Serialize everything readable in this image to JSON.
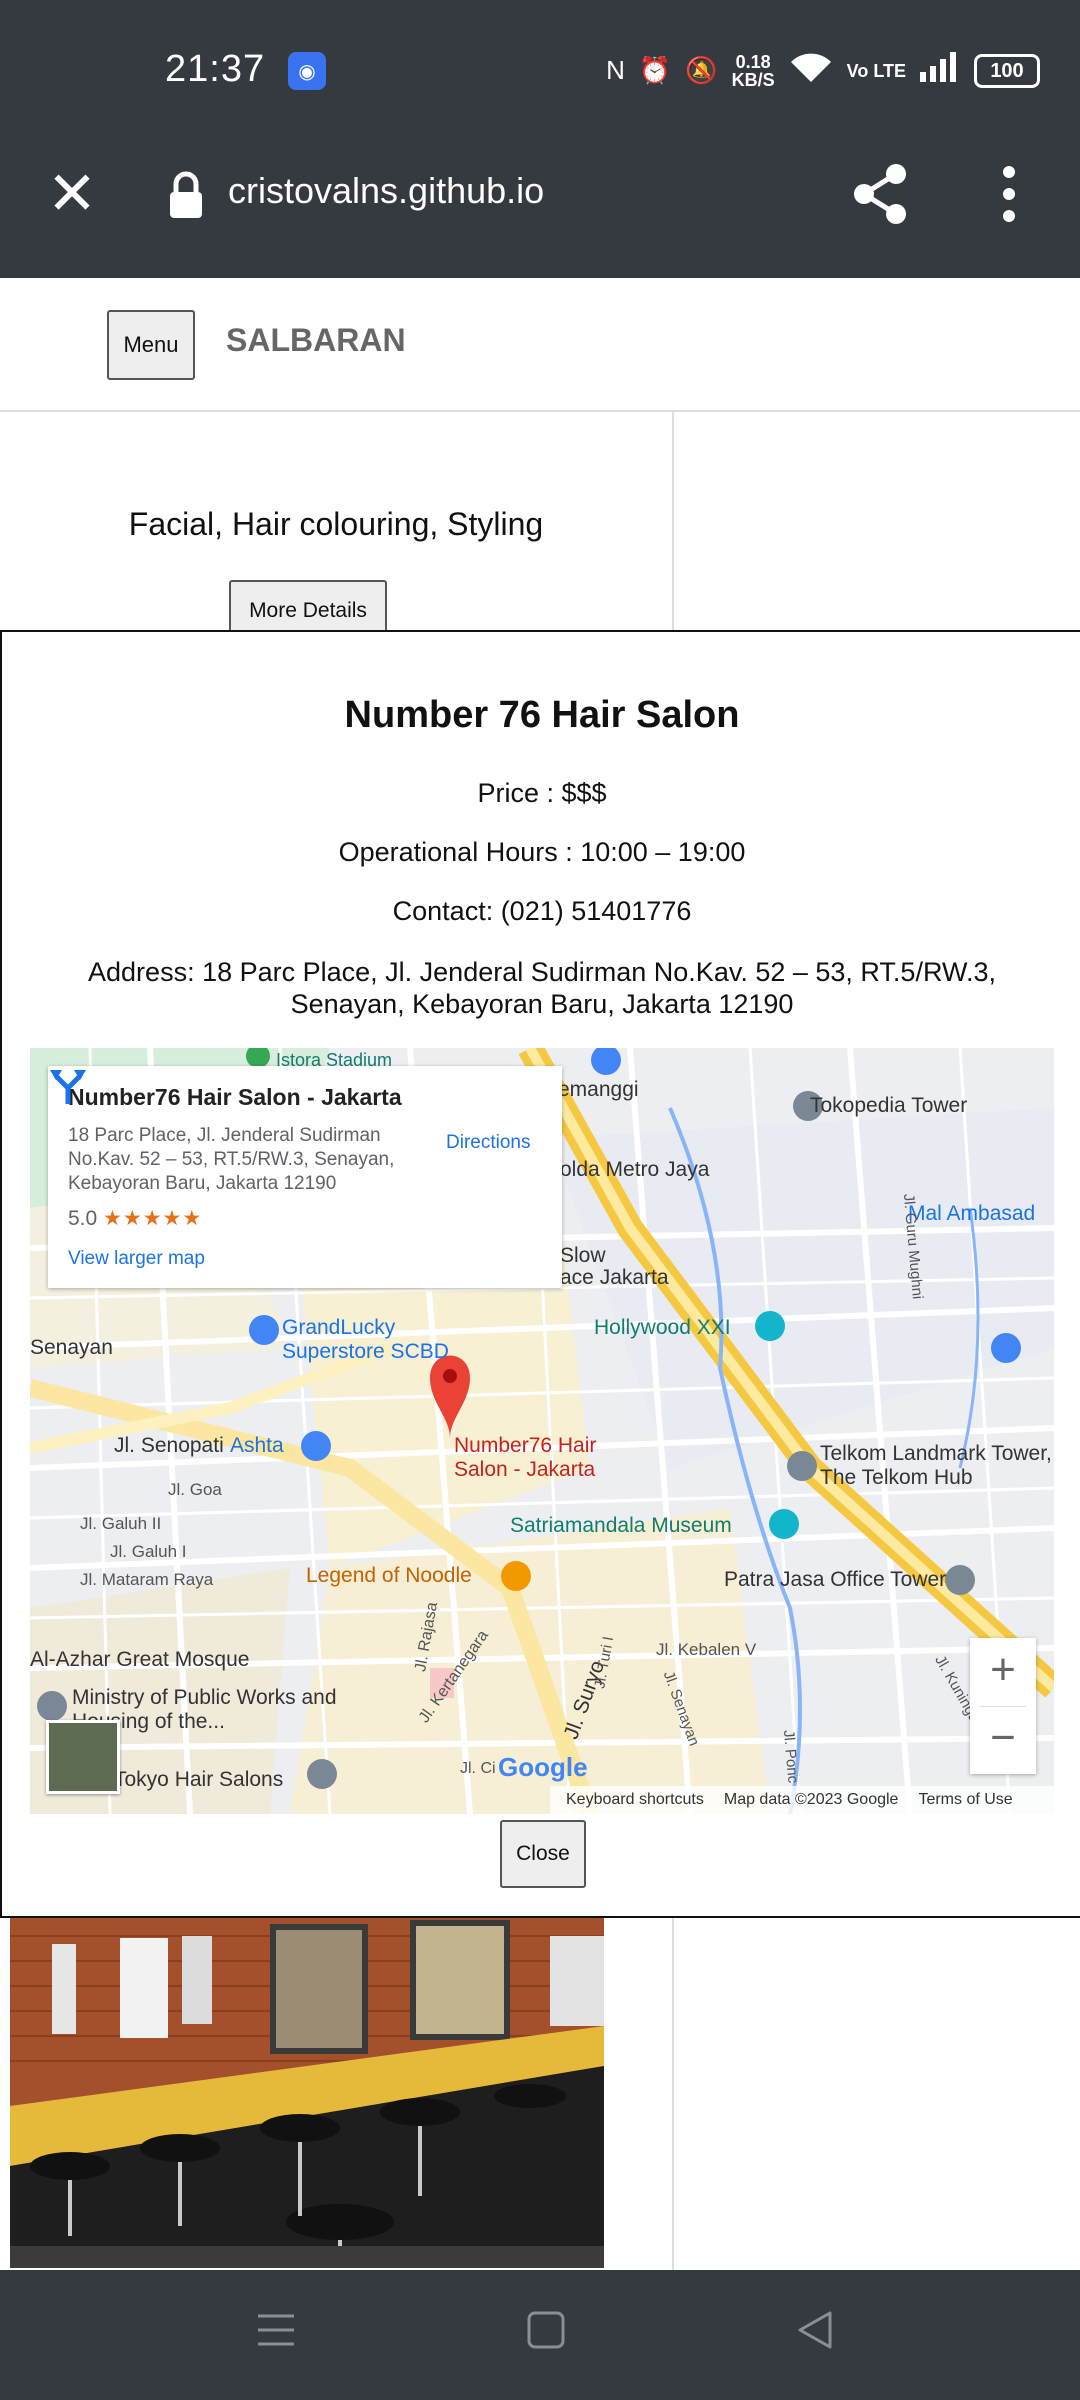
{
  "status_bar": {
    "time": "21:37",
    "speed_value": "0.18",
    "speed_unit": "KB/S",
    "network": "Vo LTE",
    "battery": "100"
  },
  "browser": {
    "url": "cristovalns.github.io"
  },
  "page": {
    "menu_label": "Menu",
    "brand": "SALBARAN",
    "services": "Facial, Hair colouring, Styling",
    "more_details_label": "More Details"
  },
  "modal": {
    "title": "Number 76 Hair Salon",
    "price": "Price : $$$",
    "hours": "Operational Hours : 10:00 – 19:00",
    "contact": "Contact: (021) 51401776",
    "address": "Address: 18 Parc Place, Jl. Jenderal Sudirman No.Kav. 52 – 53, RT.5/RW.3, Senayan, Kebayoran Baru, Jakarta 12190",
    "close_label": "Close"
  },
  "map": {
    "card": {
      "name": "Number76 Hair Salon - Jakarta",
      "address": "18 Parc Place, Jl. Jenderal Sudirman No.Kav. 52 – 53, RT.5/RW.3, Senayan, Kebayoran Baru, Jakarta 12190",
      "rating": "5.0",
      "stars": "★★★★★",
      "directions": "Directions",
      "larger_map": "View larger map"
    },
    "labels": {
      "tokopedia": "Tokopedia Tower",
      "semanggi": "emanggi",
      "polda": "olda Metro Jaya",
      "mal": "Mal Ambasad",
      "slow": "Slow",
      "plaza": "ace Jakarta",
      "hollywood": "Hollywood XXI",
      "grandlucky": "GrandLucky Superstore SCBD",
      "senayan": "Senayan",
      "senopati": "Jl. Senopati",
      "ashta": "Ashta",
      "goa": "Jl. Goa",
      "galuh2": "Jl. Galuh II",
      "galuh1": "Jl. Galuh I",
      "mataram": "Jl. Mataram Raya",
      "pin": "Number76 Hair Salon - Jakarta",
      "telkom": "Telkom Landmark Tower, The Telkom Hub",
      "satria": "Satriamandala Museum",
      "noodle": "Legend of Noodle",
      "patra": "Patra Jasa Office Tower",
      "alazhar": "Al-Azhar Great Mosque",
      "ministry": "Ministry of Public Works and Housing of the...",
      "tokyo": "Tokyo Hair Salons",
      "kebalen": "Jl. Kebalen V",
      "suryo": "Jl. Suryo",
      "rajasa": "Jl. Rajasa",
      "kertanegara": "Jl. Kertanegara",
      "guru": "Jl. Guru Mughni",
      "kuningan": "Jl. Kuningan",
      "ciput": "Jl. Ci",
      "turi": "Jl. Turi I",
      "senayan2": "Jl. Senayan",
      "ponc": "Jl. Ponc",
      "stadium": "Istora Stadium"
    },
    "google": "Google",
    "attribution": {
      "shortcuts": "Keyboard shortcuts",
      "data": "Map data ©2023 Google",
      "terms": "Terms of Use"
    }
  },
  "colors": {
    "chrome": "#353a40",
    "link": "#1a73e8",
    "pin": "#ea4335"
  }
}
